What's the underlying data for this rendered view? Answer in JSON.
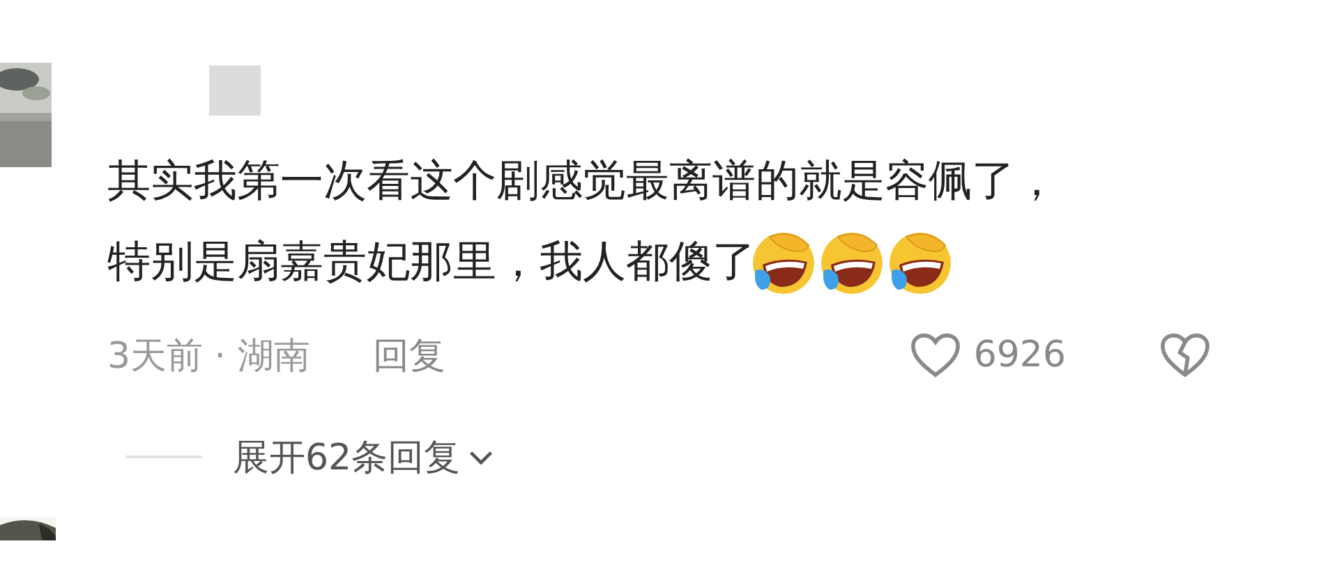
{
  "comment": {
    "avatar": {
      "kind": "picture"
    },
    "text_lines": [
      "其实我第一次看这个剧感觉最离谱的就是容佩了，",
      "特别是扇嘉贵妃那里，我人都傻了"
    ],
    "emojis": [
      {
        "kind": "laugh-cry"
      },
      {
        "kind": "laugh-cry"
      },
      {
        "kind": "laugh-cry"
      }
    ],
    "meta": "3天前 · 湖南",
    "reply_label": "回复",
    "likes": "6926",
    "liked": false,
    "disliked": false,
    "expand_label": "展开62条回复"
  },
  "next_comment": {
    "avatar": {
      "kind": "picture"
    }
  }
}
